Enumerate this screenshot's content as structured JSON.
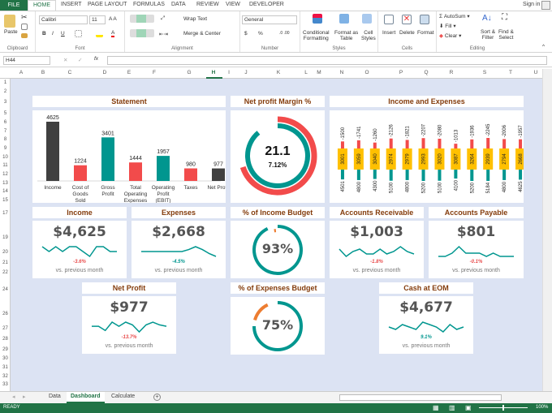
{
  "ribbon": {
    "tabs": [
      "FILE",
      "HOME",
      "INSERT",
      "PAGE LAYOUT",
      "FORMULAS",
      "DATA",
      "REVIEW",
      "VIEW",
      "DEVELOPER"
    ],
    "sign_in": "Sign in",
    "clipboard": {
      "paste": "Paste",
      "label": "Clipboard"
    },
    "font": {
      "name": "Calibri",
      "size": "11",
      "label": "Font"
    },
    "alignment": {
      "wrap": "Wrap Text",
      "merge": "Merge & Center",
      "label": "Alignment"
    },
    "number": {
      "format": "General",
      "label": "Number",
      "currency": "$",
      "percent": "%"
    },
    "styles": {
      "cond": "Conditional",
      "cond2": "Formatting",
      "fmt_table": "Format as",
      "fmt_table2": "Table",
      "cell_styles": "Cell",
      "cell_styles2": "Styles",
      "label": "Styles"
    },
    "cells": {
      "insert": "Insert",
      "delete": "Delete",
      "format": "Format",
      "label": "Cells"
    },
    "editing": {
      "autosum": "AutoSum",
      "fill": "Fill",
      "clear": "Clear",
      "sort": "Sort &",
      "sort2": "Filter",
      "find": "Find &",
      "find2": "Select",
      "label": "Editing"
    }
  },
  "formula_bar": {
    "name_box": "H44",
    "value": ""
  },
  "columns": [
    "A",
    "B",
    "C",
    "D",
    "E",
    "F",
    "G",
    "H",
    "I",
    "J",
    "K",
    "L",
    "M",
    "N",
    "O",
    "P",
    "Q",
    "R",
    "S",
    "T",
    "U"
  ],
  "selected_column": "H",
  "rows": [
    "1",
    "2",
    "3",
    "5",
    "6",
    "7",
    "8",
    "9",
    "10",
    "11",
    "12",
    "13",
    "14",
    "15",
    "17",
    "19",
    "20",
    "21",
    "22",
    "24",
    "26",
    "27",
    "28",
    "29",
    "30",
    "31",
    "32",
    "33"
  ],
  "colors": {
    "teal": "#00968f",
    "red": "#f24b4b",
    "dark": "#404040",
    "yellow": "#ffc000",
    "orange": "#ed7d31",
    "title": "#843c0c",
    "excel_green": "#217346"
  },
  "statement": {
    "title": "Statement",
    "chart_data": {
      "type": "bar",
      "categories": [
        "Income",
        "Cost of Goods Sold",
        "Gross Profit",
        "Total Operating Expenses",
        "Operating Profit (EBIT)",
        "Taxes",
        "Net Profit"
      ],
      "values": [
        4625,
        1224,
        3401,
        1444,
        1957,
        980,
        977
      ],
      "bar_colors": [
        "#404040",
        "#f24b4b",
        "#00968f",
        "#f24b4b",
        "#00968f",
        "#f24b4b",
        "#404040"
      ]
    }
  },
  "net_profit_margin": {
    "title": "Net profit Margin %",
    "value": "21.1",
    "sub": "7.12%",
    "outer_fraction": 0.7,
    "inner_fraction": 0.89
  },
  "income_expenses": {
    "title": "Income and Expenses",
    "chart_data": {
      "type": "bar",
      "expenses": [
        -1500,
        -1741,
        -1260,
        -2126,
        -1821,
        -2207,
        -2080,
        -1013,
        -1936,
        -2245,
        -2006,
        -1957
      ],
      "net": [
        3001,
        3059,
        3040,
        2974,
        2979,
        2993,
        3020,
        3087,
        3264,
        2939,
        2794,
        2668
      ],
      "income": [
        4501,
        4800,
        4300,
        5100,
        4800,
        5200,
        5100,
        4100,
        5200,
        5184,
        4800,
        4625
      ]
    }
  },
  "kpis": [
    {
      "title": "Income",
      "value": "$4,625",
      "change": "-3.6%",
      "change_color": "#e84c4c",
      "caption": "vs. previous month",
      "spark": [
        5,
        4,
        5,
        4,
        5,
        5,
        4,
        3,
        5,
        5,
        4,
        4
      ]
    },
    {
      "title": "Expenses",
      "value": "$2,668",
      "change": "-4.5%",
      "change_color": "#00968f",
      "caption": "vs. previous month",
      "spark": [
        5,
        5,
        5,
        5,
        5,
        5,
        5,
        5.2,
        5.5,
        5.2,
        4.8,
        4.5
      ]
    },
    {
      "title": "Accounts Receivable",
      "value": "$1,003",
      "change": "-1.8%",
      "change_color": "#e84c4c",
      "caption": "vs. previous month",
      "spark": [
        6,
        3,
        5,
        6,
        4,
        4,
        6,
        4,
        5,
        7,
        5,
        4
      ]
    },
    {
      "title": "Accounts Payable",
      "value": "$801",
      "change": "-0.1%",
      "change_color": "#e84c4c",
      "caption": "vs. previous month",
      "spark": [
        4,
        4,
        5,
        7,
        5,
        5,
        5,
        4,
        5,
        4,
        4,
        4
      ]
    },
    {
      "title": "Net Profit",
      "value": "$977",
      "change": "-13.7%",
      "change_color": "#e84c4c",
      "caption": "vs. previous month",
      "spark": [
        5,
        5,
        2,
        8,
        5,
        8,
        6,
        1,
        6,
        8,
        6,
        5
      ]
    },
    {
      "title": "Cash at EOM",
      "value": "$4,677",
      "change": "9.1%",
      "change_color": "#00968f",
      "caption": "vs. previous month",
      "spark": [
        4,
        3,
        5,
        4,
        3,
        6,
        5,
        4,
        2,
        5,
        3,
        4
      ]
    }
  ],
  "income_budget": {
    "title": "% of Income Budget",
    "value": "93%",
    "fraction": 0.93
  },
  "expenses_budget": {
    "title": "% of Expenses Budget",
    "value": "75%",
    "fraction": 0.75
  },
  "sheets": [
    "Data",
    "Dashboard",
    "Calculate"
  ],
  "active_sheet": "Dashboard",
  "status": {
    "ready": "READY",
    "zoom": "100%"
  }
}
